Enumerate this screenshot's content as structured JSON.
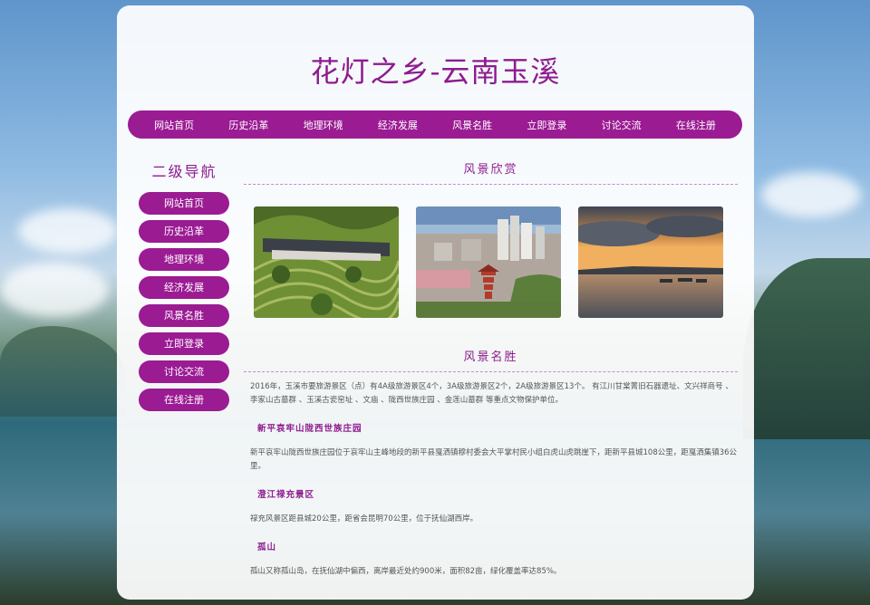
{
  "header": {
    "title": "花灯之乡-云南玉溪"
  },
  "main_nav": [
    "网站首页",
    "历史沿革",
    "地理环境",
    "经济发展",
    "风景名胜",
    "立即登录",
    "讨论交流",
    "在线注册"
  ],
  "sidebar": {
    "title": "二级导航",
    "items": [
      "网站首页",
      "历史沿革",
      "地理环境",
      "经济发展",
      "风景名胜",
      "立即登录",
      "讨论交流",
      "在线注册"
    ]
  },
  "gallery": {
    "title": "风景欣赏",
    "images": [
      {
        "name": "tea-terrace-photo",
        "colors": [
          "#7a9a3e",
          "#4e6a2b",
          "#a7b85f"
        ]
      },
      {
        "name": "city-pagoda-photo",
        "colors": [
          "#6a8fb8",
          "#b6a49a",
          "#b5553f"
        ]
      },
      {
        "name": "lake-sunset-photo",
        "colors": [
          "#e08a3c",
          "#5a5f6a",
          "#3d4455"
        ]
      }
    ]
  },
  "scenic": {
    "title": "风景名胜",
    "intro": "2016年，玉溪市要旅游景区（点）有4A级旅游景区4个，3A级旅游景区2个，2A级旅游景区13个。 有江川甘棠箐旧石器遗址、文兴祥商号 、李家山古墓群 、玉溪古瓷窑址 、文庙 、陇西世族庄园 、金莲山墓群 等重点文物保护单位。",
    "spots": [
      {
        "name": "新平哀牢山陇西世族庄园",
        "desc": "新平哀牢山陇西世族庄园位于哀牢山主峰地段的新平县戛洒镇穆村委会大平掌村民小组白虎山虎跳崖下，距新平县城108公里，距戛洒集镇36公里。"
      },
      {
        "name": "澄江禄充景区",
        "desc": "禄充风景区距县城20公里，距省会昆明70公里，位于抚仙湖西岸。"
      },
      {
        "name": "孤山",
        "desc": "孤山又称孤山岛，在抚仙湖中偏西，离岸最近处约900米，面积82亩，绿化覆盖率达85%。"
      }
    ]
  }
}
